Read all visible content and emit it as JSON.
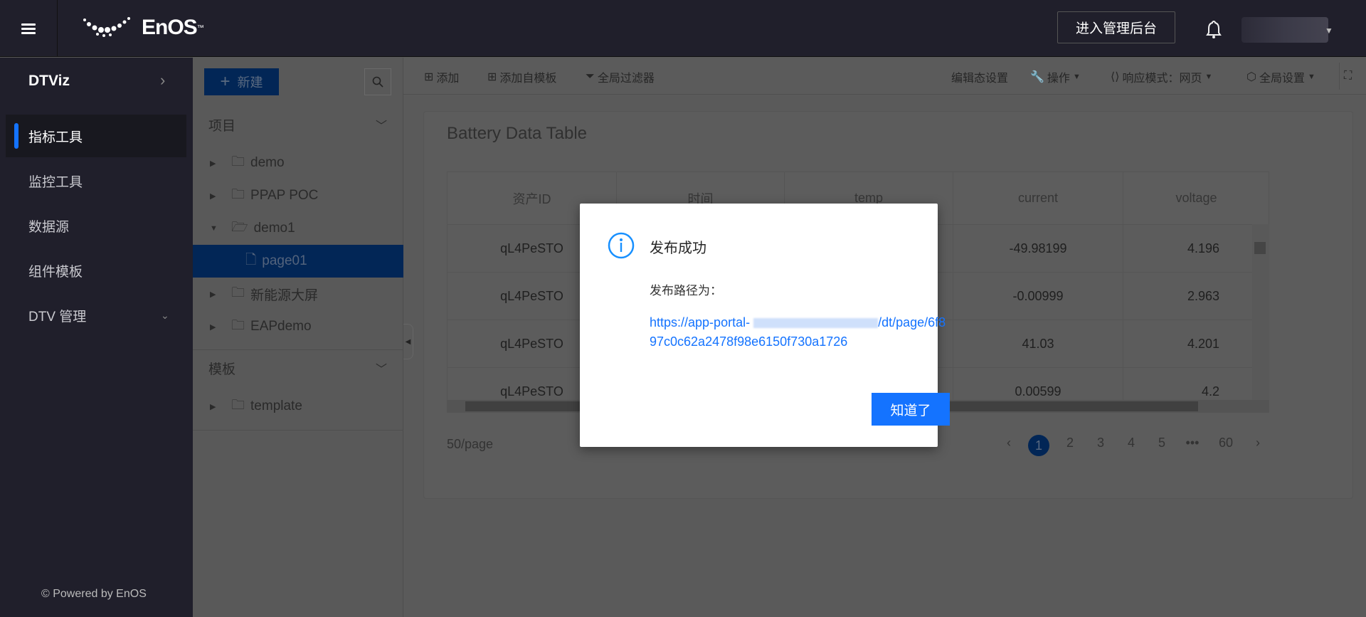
{
  "header": {
    "brand": "EnOS",
    "tm": "™",
    "admin_button": "进入管理后台"
  },
  "sidebar": {
    "title": "DTViz",
    "items": [
      {
        "label": "指标工具",
        "active": true
      },
      {
        "label": "监控工具"
      },
      {
        "label": "数据源"
      },
      {
        "label": "组件模板"
      },
      {
        "label": "DTV 管理"
      }
    ],
    "footer": "© Powered by EnOS"
  },
  "tree": {
    "new_button": "新建",
    "projects_header": "项目",
    "templates_header": "模板",
    "projects": [
      {
        "label": "demo"
      },
      {
        "label": "PPAP POC"
      },
      {
        "label": "demo1",
        "expanded": true
      },
      {
        "label": "page01",
        "selected": true
      },
      {
        "label": "新能源大屏"
      },
      {
        "label": "EAPdemo"
      }
    ],
    "templates": [
      {
        "label": "template"
      }
    ]
  },
  "toolbar": {
    "add": "添加",
    "add_from_template": "添加自模板",
    "global_filter": "全局过滤器",
    "edit_settings": "编辑态设置",
    "operations": "操作",
    "responsive_mode": "响应模式：网页",
    "global_settings": "全局设置"
  },
  "card": {
    "title": "Battery Data Table",
    "table": {
      "columns": [
        "资产ID",
        "时间",
        "temp",
        "current",
        "voltage"
      ],
      "rows": [
        [
          "qL4PeSTO",
          "",
          "",
          "-49.98199",
          "4.196"
        ],
        [
          "qL4PeSTO",
          "",
          "",
          "-0.00999",
          "2.963"
        ],
        [
          "qL4PeSTO",
          "",
          "",
          "41.03",
          "4.201"
        ],
        [
          "qL4PeSTO",
          "",
          "",
          "0.00599",
          "4.2"
        ]
      ]
    },
    "pagination": {
      "per_page": "50/page",
      "pages": [
        "1",
        "2",
        "3",
        "4",
        "5",
        "•••",
        "60"
      ],
      "current": "1"
    }
  },
  "modal": {
    "title": "发布成功",
    "label": "发布路径为：",
    "link_start": "https://app-portal-",
    "link_end": "/dt/page/6f897c0c62a2478f98e6150f730a1726",
    "ok_button": "知道了"
  },
  "colors": {
    "accent": "#1473ff",
    "topbar": "#201f2b"
  }
}
